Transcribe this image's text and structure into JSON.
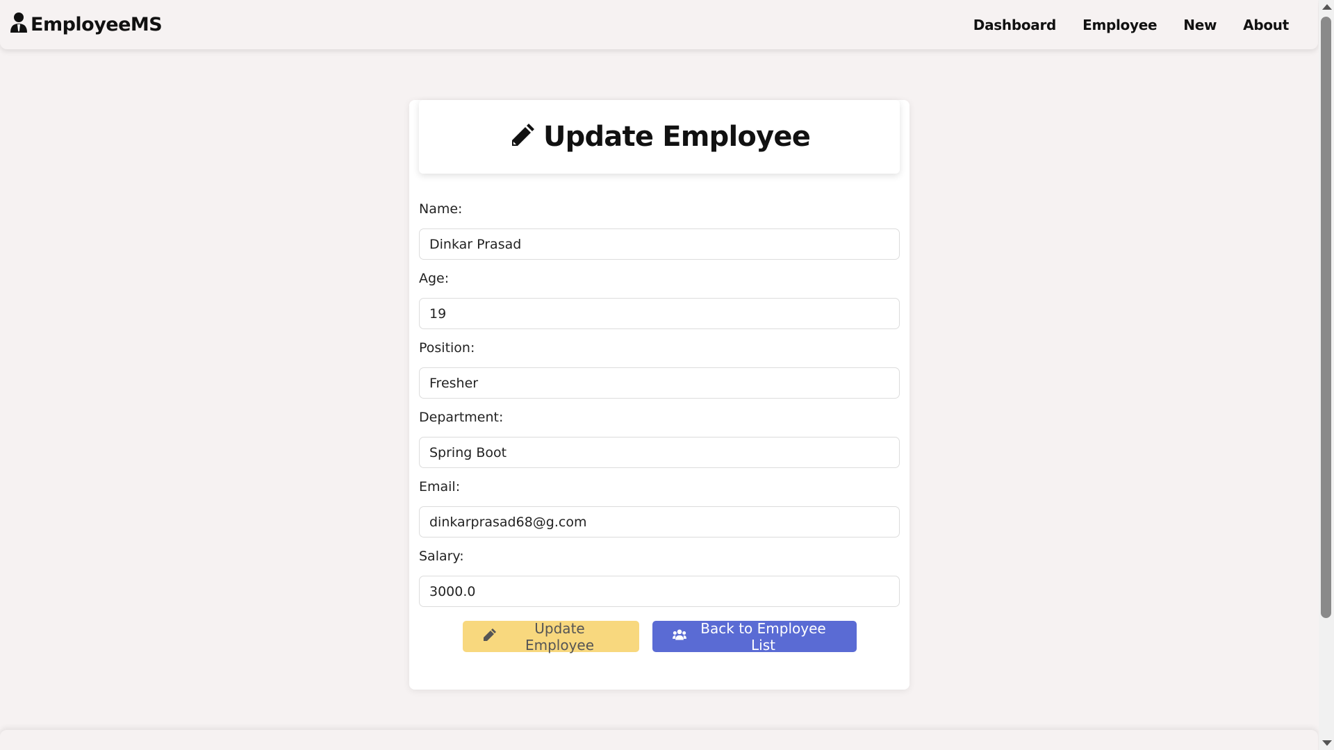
{
  "brand": {
    "name": "EmployeeMS",
    "icon": "user-tie-icon"
  },
  "nav": {
    "items": [
      {
        "label": "Dashboard"
      },
      {
        "label": "Employee"
      },
      {
        "label": "New"
      },
      {
        "label": "About"
      }
    ]
  },
  "form": {
    "title": "Update Employee",
    "title_icon": "pencil-icon",
    "fields": [
      {
        "label": "Name:",
        "value": "Dinkar Prasad"
      },
      {
        "label": "Age:",
        "value": "19"
      },
      {
        "label": "Position:",
        "value": "Fresher"
      },
      {
        "label": "Department:",
        "value": "Spring Boot"
      },
      {
        "label": "Email:",
        "value": "dinkarprasad68@g.com"
      },
      {
        "label": "Salary:",
        "value": "3000.0"
      }
    ],
    "update_label": "Update Employee",
    "back_label": "Back to Employee List"
  },
  "colors": {
    "background": "#f6f2f2",
    "update_button": "#f8d87e",
    "back_button": "#5a6bd4"
  }
}
